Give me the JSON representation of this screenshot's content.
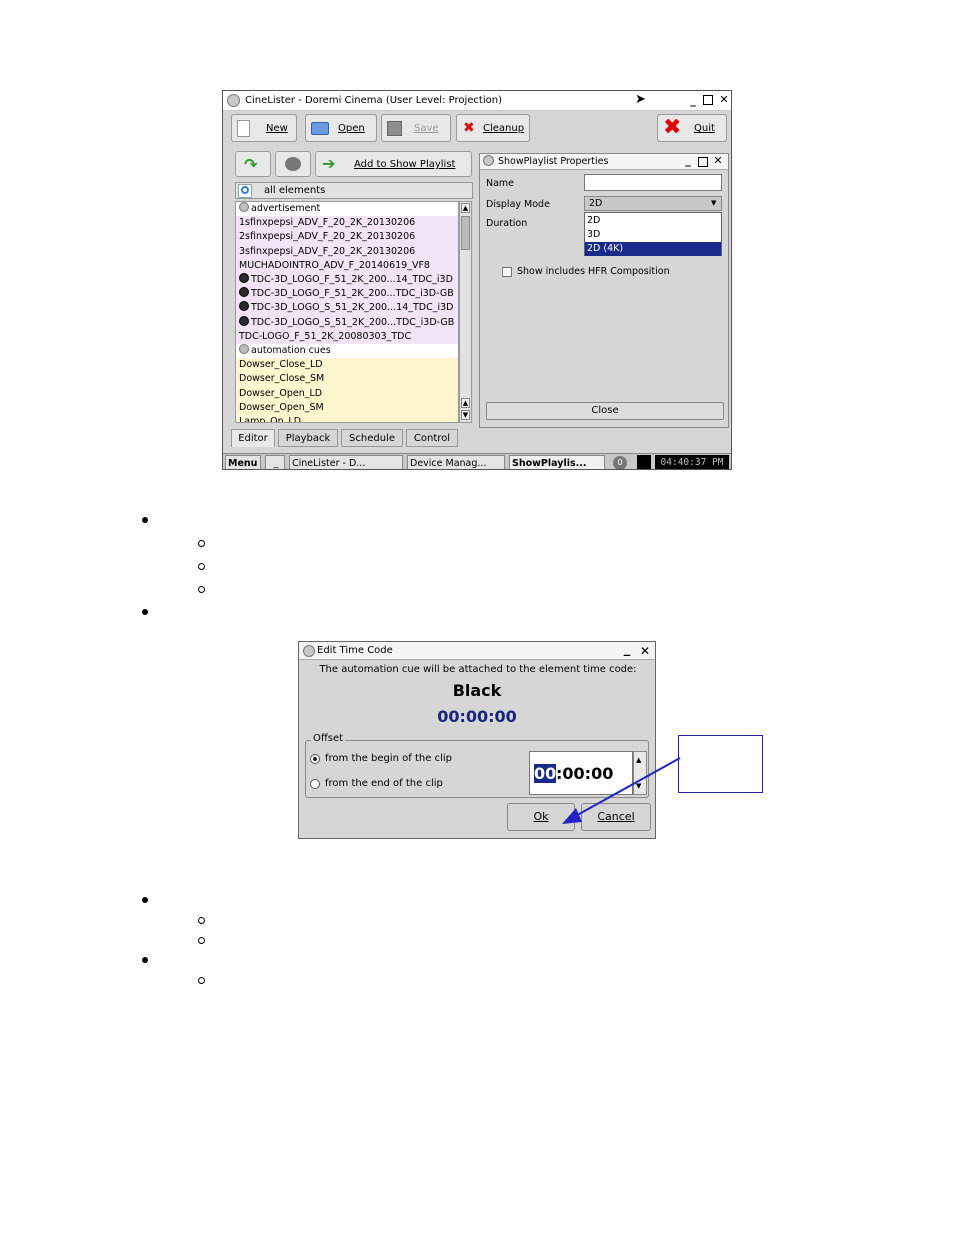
{
  "cinelister": {
    "title": "CineLister - Doremi Cinema (User Level: Projection)",
    "toolbar": {
      "new": "New",
      "open": "Open",
      "save": "Save",
      "cleanup": "Cleanup",
      "quit": "Quit"
    },
    "add_to_playlist": "Add to Show Playlist",
    "filter": "all elements",
    "list_items": [
      {
        "text": "advertisement",
        "style": "white",
        "icon": "gear"
      },
      {
        "text": "1sfinxpepsi_ADV_F_20_2K_20130206",
        "style": "purple",
        "icon": ""
      },
      {
        "text": "2sfinxpepsi_ADV_F_20_2K_20130206",
        "style": "purple",
        "icon": ""
      },
      {
        "text": "3sfinxpepsi_ADV_F_20_2K_20130206",
        "style": "purple",
        "icon": ""
      },
      {
        "text": "MUCHADOINTRO_ADV_F_20140619_VF8",
        "style": "purple",
        "icon": ""
      },
      {
        "text": "TDC-3D_LOGO_F_51_2K_200...14_TDC_i3D",
        "style": "purple",
        "icon": "ball"
      },
      {
        "text": "TDC-3D_LOGO_F_51_2K_200...TDC_i3D-GB",
        "style": "purple",
        "icon": "ball"
      },
      {
        "text": "TDC-3D_LOGO_S_51_2K_200...14_TDC_i3D",
        "style": "purple",
        "icon": "ball"
      },
      {
        "text": "TDC-3D_LOGO_S_51_2K_200...TDC_i3D-GB",
        "style": "purple",
        "icon": "ball"
      },
      {
        "text": "TDC-LOGO_F_51_2K_20080303_TDC",
        "style": "purple",
        "icon": ""
      },
      {
        "text": "automation cues",
        "style": "white",
        "icon": "gear"
      },
      {
        "text": "Dowser_Close_LD",
        "style": "yellow",
        "icon": ""
      },
      {
        "text": "Dowser_Close_SM",
        "style": "yellow",
        "icon": ""
      },
      {
        "text": "Dowser_Open_LD",
        "style": "yellow",
        "icon": ""
      },
      {
        "text": "Dowser_Open_SM",
        "style": "yellow",
        "icon": ""
      },
      {
        "text": "Lamp_On_LD",
        "style": "yellow",
        "icon": ""
      }
    ],
    "tabs": [
      "Editor",
      "Playback",
      "Schedule",
      "Control"
    ],
    "props": {
      "title": "ShowPlaylist Properties",
      "name_label": "Name",
      "name_value": "",
      "display_mode_label": "Display Mode",
      "display_mode_value": "2D",
      "duration_label": "Duration",
      "options": [
        "2D",
        "3D",
        "2D (4K)"
      ],
      "selected_option": "2D (4K)",
      "hfr_label": "Show includes HFR Composition",
      "close": "Close"
    },
    "taskbar": {
      "menu": "Menu",
      "items": [
        "CineLister - D...",
        "Device Manag...",
        "ShowPlaylis..."
      ],
      "badge": "0",
      "clock": "04:40:37 PM"
    }
  },
  "timecode_dialog": {
    "title": "Edit Time Code",
    "message": "The automation cue will be attached to the element time code:",
    "element": "Black",
    "timecode": "00:00:00",
    "offset_label": "Offset",
    "option_begin": "from the begin of the clip",
    "option_end": "from the end of the clip",
    "field_hours": "00",
    "field_rest": ":00:00",
    "ok": "Ok",
    "cancel": "Cancel"
  },
  "colors": {
    "selection": "#1a2a8a",
    "timecode": "#1a237e",
    "arrow": "#2323c8"
  }
}
